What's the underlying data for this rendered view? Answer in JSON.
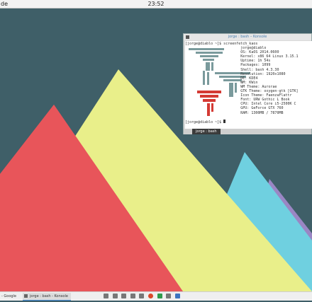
{
  "topbar": {
    "left_text": "de",
    "clock": "23:52"
  },
  "konsole": {
    "title": "jorge : bash – Konsole",
    "tab_label": "jorge : bash",
    "lines": [
      "[jorge@diablo ~]$ screenfetch_kaos",
      "                          jorge@diablo",
      "                          OS: KaOS 2014.0600",
      "                          Kernel: x86_64 Linux 3.15.1",
      "                          Uptime: 1h 54s",
      "                          Packages: 1099",
      "                          Shell: bash 4.3.30",
      "                          Resolution: 1920x1080",
      "                          DE: KDE4",
      "                          WM: KWin",
      "                          WM Theme: Aurorae",
      "                          GTK Theme: oxygen-gtk [GTK]",
      "                          Icon Theme: FaenzaFlattr",
      "                          Font: URW Gothic L Book",
      "                          CPU: Intel Core i5-2500K C",
      "                          GPU: GeForce GTX 760",
      "                          RAM: 1300MB / 7870MB",
      "",
      "[jorge@diablo ~]$ "
    ]
  },
  "taskbar": {
    "search_label": "- Google",
    "task_label": "jorge : bash - Konsole"
  },
  "colors": {
    "background": "#3f5f68",
    "red": "#e8555a",
    "yellow": "#e9ef8a",
    "cyan": "#6fd0e0",
    "purple": "#9a86c4"
  }
}
